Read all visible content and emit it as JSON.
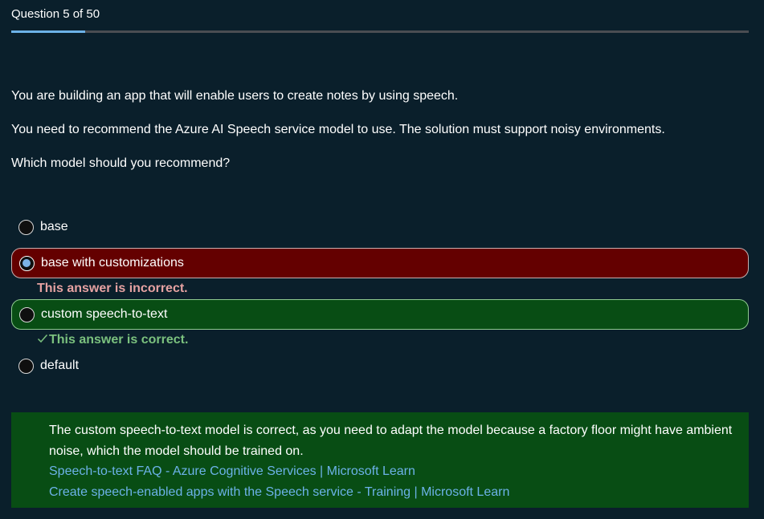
{
  "header": {
    "question_counter": "Question 5 of 50",
    "progress_fraction": 0.1
  },
  "question": {
    "paragraphs": [
      "You are building an app that will enable users to create notes by using speech.",
      "You need to recommend the Azure AI Speech service model to use. The solution must support noisy environments.",
      "Which model should you recommend?"
    ]
  },
  "options": [
    {
      "label": "base",
      "selected": false,
      "state": "neutral"
    },
    {
      "label": "base with customizations",
      "selected": true,
      "state": "incorrect"
    },
    {
      "label": "custom speech-to-text",
      "selected": false,
      "state": "correct"
    },
    {
      "label": "default",
      "selected": false,
      "state": "neutral"
    }
  ],
  "feedback": {
    "incorrect": "This answer is incorrect.",
    "correct": "This answer is correct."
  },
  "explanation": {
    "text": "The custom speech-to-text model is correct, as you need to adapt the model because a factory floor might have ambient noise, which the model should be trained on.",
    "links": [
      "Speech-to-text FAQ - Azure Cognitive Services | Microsoft Learn",
      "Create speech-enabled apps with the Speech service - Training | Microsoft Learn"
    ]
  },
  "colors": {
    "background": "#0a1f2b",
    "progress_fill": "#6cb2e8",
    "incorrect_bg": "#640000",
    "correct_bg": "#084d14",
    "link": "#6cb2e8"
  }
}
